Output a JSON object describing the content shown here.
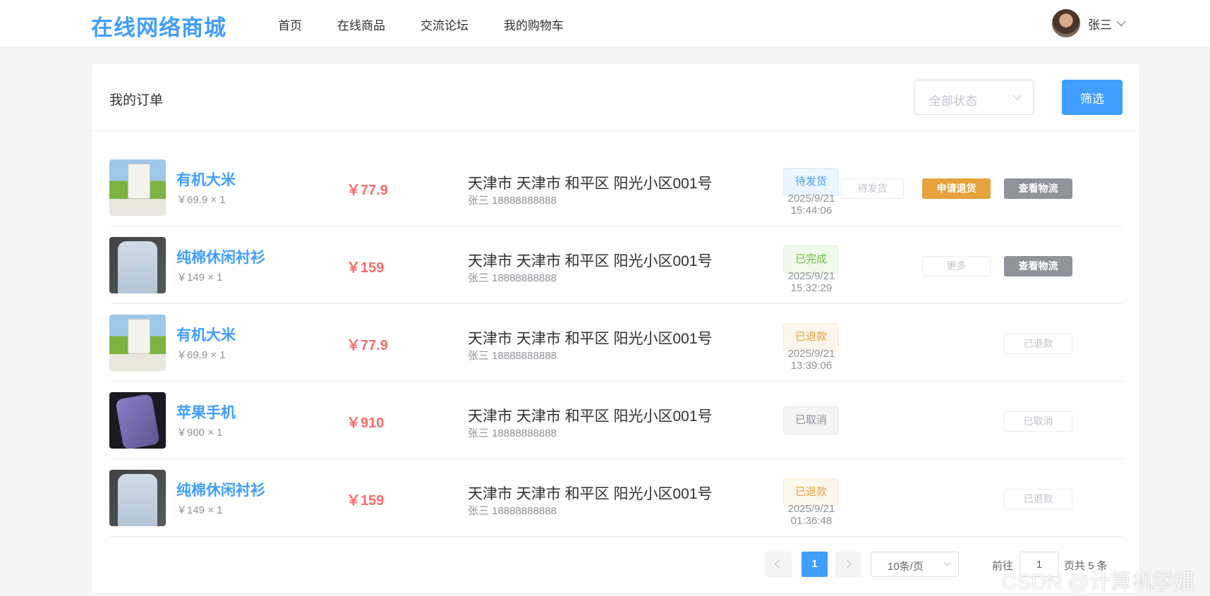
{
  "header": {
    "logo": "在线网络商城",
    "nav": [
      "首页",
      "在线商品",
      "交流论坛",
      "我的购物车"
    ],
    "user_name": "张三"
  },
  "card": {
    "title": "我的订单",
    "status_placeholder": "全部状态",
    "filter_label": "筛选"
  },
  "orders": [
    {
      "product": "有机大米",
      "meta": "￥69.9 × 1",
      "total": "￥77.9",
      "address": "天津市 天津市 和平区 阳光小区001号",
      "contact": "张三 18888888888",
      "status": "待发货",
      "time": "2025/9/21 15:44:06",
      "actions": [
        "待发货",
        "申请退货",
        "查看物流"
      ]
    },
    {
      "product": "纯棉休闲衬衫",
      "meta": "￥149 × 1",
      "total": "￥159",
      "address": "天津市 天津市 和平区 阳光小区001号",
      "contact": "张三 18888888888",
      "status": "已完成",
      "time": "2025/9/21 15:32:29",
      "actions": [
        "更多",
        "查看物流"
      ]
    },
    {
      "product": "有机大米",
      "meta": "￥69.9 × 1",
      "total": "￥77.9",
      "address": "天津市 天津市 和平区 阳光小区001号",
      "contact": "张三 18888888888",
      "status": "已退款",
      "time": "2025/9/21 13:39:06",
      "actions": [
        "已退款"
      ]
    },
    {
      "product": "苹果手机",
      "meta": "￥900 × 1",
      "total": "￥910",
      "address": "天津市 天津市 和平区 阳光小区001号",
      "contact": "张三 18888888888",
      "status": "已取消",
      "time": "",
      "actions": [
        "已取消"
      ]
    },
    {
      "product": "纯棉休闲衬衫",
      "meta": "￥149 × 1",
      "total": "￥159",
      "address": "天津市 天津市 和平区 阳光小区001号",
      "contact": "张三 18888888888",
      "status": "已退款",
      "time": "2025/9/21 01:36:48",
      "actions": [
        "已退款"
      ]
    }
  ],
  "pagination": {
    "current_page": "1",
    "page_size": "10条/页",
    "goto_label": "前往",
    "goto_value": "1",
    "total_text": "页共 5 条"
  },
  "watermark": "CSDN @计算机学姐",
  "colors": {
    "primary": "#409eff",
    "price": "#f56c6c",
    "warning": "#e6a23c",
    "success": "#67c23a",
    "info_gray": "#909399"
  }
}
